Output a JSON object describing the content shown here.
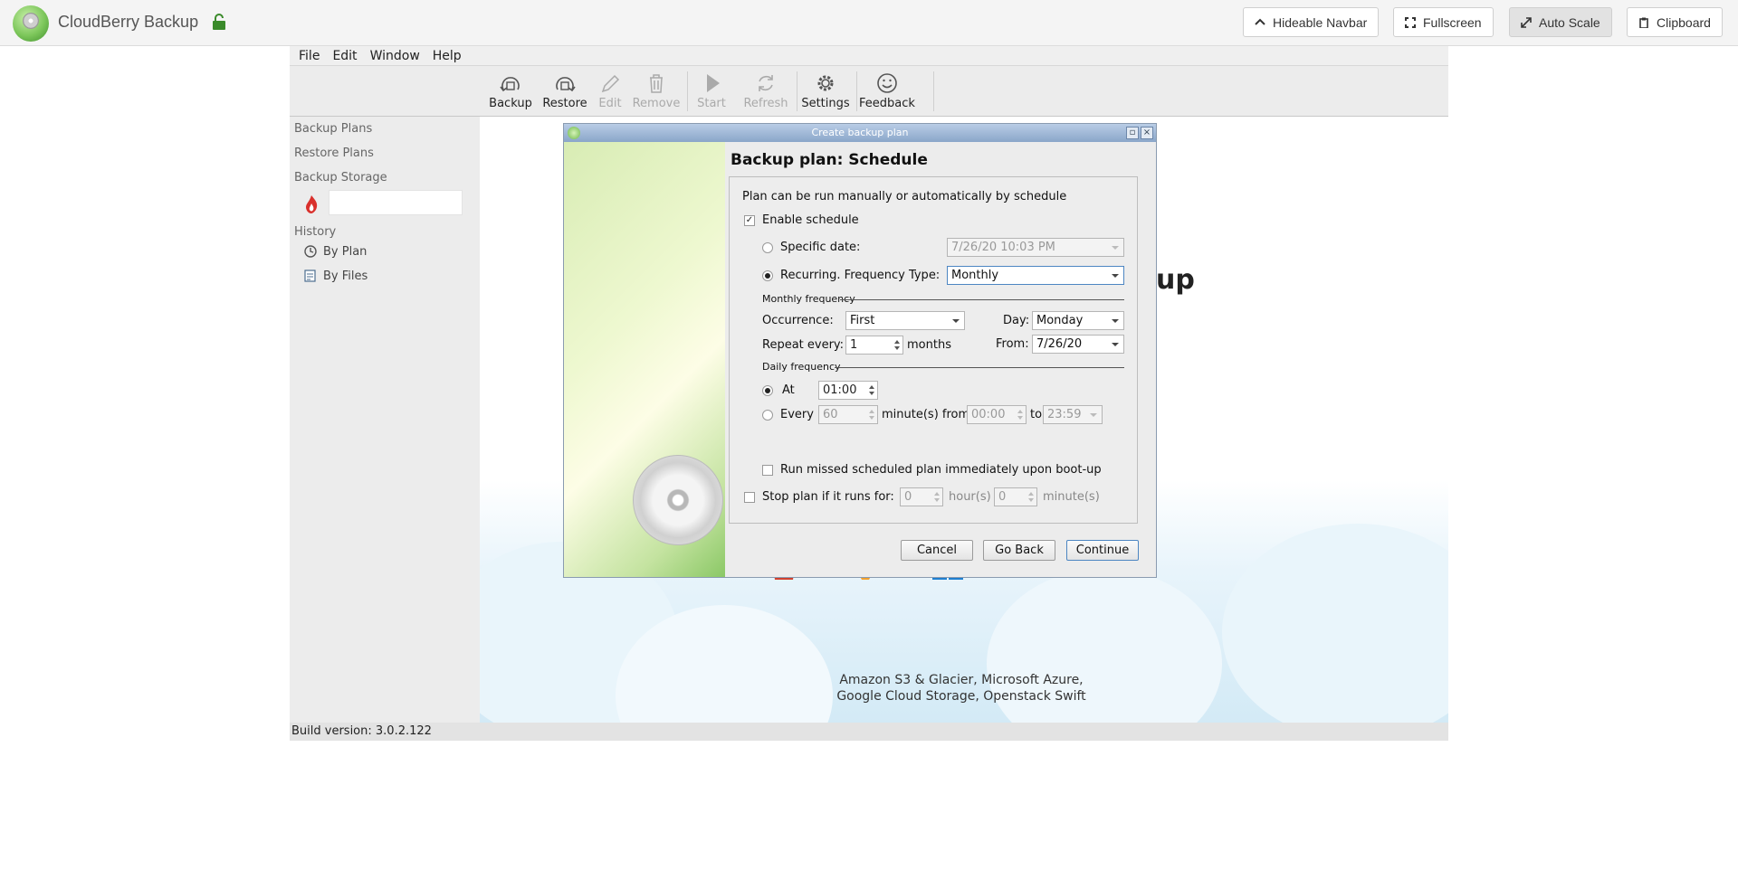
{
  "navbar": {
    "app_title": "CloudBerry Backup",
    "buttons": {
      "hideable_navbar": "Hideable Navbar",
      "fullscreen": "Fullscreen",
      "auto_scale": "Auto Scale",
      "clipboard": "Clipboard"
    }
  },
  "menu": [
    "File",
    "Edit",
    "Window",
    "Help"
  ],
  "toolbar": {
    "backup": "Backup",
    "restore": "Restore",
    "edit": "Edit",
    "remove": "Remove",
    "start": "Start",
    "refresh": "Refresh",
    "settings": "Settings",
    "feedback": "Feedback"
  },
  "sidebar": {
    "backup_plans": "Backup Plans",
    "restore_plans": "Restore Plans",
    "backup_storage": "Backup Storage",
    "history": "History",
    "by_plan": "By Plan",
    "by_files": "By Files"
  },
  "background": {
    "title_fragment": "up",
    "caption_line1": "Amazon S3 & Glacier, Microsoft Azure,",
    "caption_line2": "Google Cloud Storage, Openstack Swift"
  },
  "status": {
    "build": "Build version: 3.0.2.122"
  },
  "dialog": {
    "title": "Create backup plan",
    "heading": "Backup plan: Schedule",
    "intro": "Plan can be run manually or automatically by schedule",
    "enable_schedule": "Enable schedule",
    "enable_schedule_checked": true,
    "specific_date_label": "Specific date:",
    "specific_date_value": "7/26/20 10:03 PM",
    "recurring_label": "Recurring. Frequency Type:",
    "frequency_type": "Monthly",
    "monthly_frequency": "Monthly frequency",
    "occurrence_label": "Occurrence:",
    "occurrence_value": "First",
    "day_label": "Day:",
    "day_value": "Monday",
    "repeat_every_label": "Repeat every:",
    "repeat_every_value": "1",
    "months_label": "months",
    "from_label": "From:",
    "from_value": "7/26/20",
    "daily_frequency": "Daily frequency",
    "at_label": "At",
    "at_value": "01:00",
    "every_label": "Every",
    "every_value": "60",
    "minutes_from_label": "minute(s) from",
    "from_time": "00:00",
    "to_label": "to",
    "to_time": "23:59",
    "run_missed": "Run missed scheduled plan immediately upon boot-up",
    "stop_plan": "Stop plan if it runs for:",
    "stop_hours": "0",
    "hours_label": "hour(s)",
    "stop_minutes": "0",
    "minutes_label": "minute(s)",
    "cancel": "Cancel",
    "go_back": "Go Back",
    "continue": "Continue"
  },
  "colors": {
    "accent": "#4d86c2",
    "title_bar": "#8aa6c9",
    "storage_icon": "#d9302c"
  }
}
